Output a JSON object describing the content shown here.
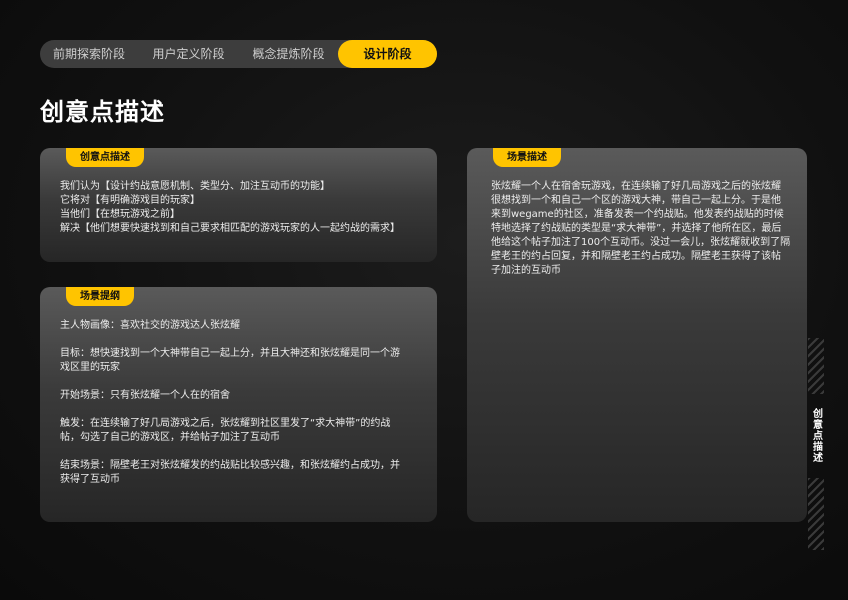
{
  "stages": [
    {
      "label": "前期探索阶段",
      "active": false
    },
    {
      "label": "用户定义阶段",
      "active": false
    },
    {
      "label": "概念提炼阶段",
      "active": false
    },
    {
      "label": "设计阶段",
      "active": true
    }
  ],
  "page_title": "创意点描述",
  "idea_card": {
    "tag": "创意点描述",
    "lines": [
      "我们认为【设计约战意愿机制、类型分、加注互动币的功能】",
      "它将对【有明确游戏目的玩家】",
      "当他们【在想玩游戏之前】",
      "解决【他们想要快速找到和自己要求相匹配的游戏玩家的人一起约战的需求】"
    ]
  },
  "outline_card": {
    "tag": "场景提纲",
    "paragraphs": [
      [
        "主人物画像：喜欢社交的游戏达人张炫耀"
      ],
      [
        "目标：想快速找到一个大神带自己一起上分，并且大神还和张炫耀是同一个游",
        "戏区里的玩家"
      ],
      [
        "开始场景：只有张炫耀一个人在的宿舍"
      ],
      [
        "触发：在连续输了好几局游戏之后，张炫耀到社区里发了“求大神带”的约战",
        "帖，勾选了自己的游戏区，并给帖子加注了互动币"
      ],
      [
        "结束场景：隔壁老王对张炫耀发的约战贴比较感兴趣，和张炫耀约占成功，并",
        "获得了互动币"
      ]
    ]
  },
  "scene_card": {
    "tag": "场景描述",
    "lines": [
      "张炫耀一个人在宿舍玩游戏，在连续输了好几局游戏之后的张炫耀",
      "很想找到一个和自己一个区的游戏大神，带自己一起上分。于是他",
      "来到wegame的社区，准备发表一个约战贴。他发表约战贴的时候",
      "特地选择了约战贴的类型是“求大神带”，并选择了他所在区，最后",
      "他给这个帖子加注了100个互动币。没过一会儿，张炫耀就收到了隔",
      "壁老王的约占回复，并和隔壁老王约占成功。隔壁老王获得了该帖",
      "子加注的互动币"
    ]
  },
  "side_label": "创意点描述",
  "colors": {
    "accent": "#ffc400",
    "background": "#101010",
    "card": "#3a3a3a"
  }
}
